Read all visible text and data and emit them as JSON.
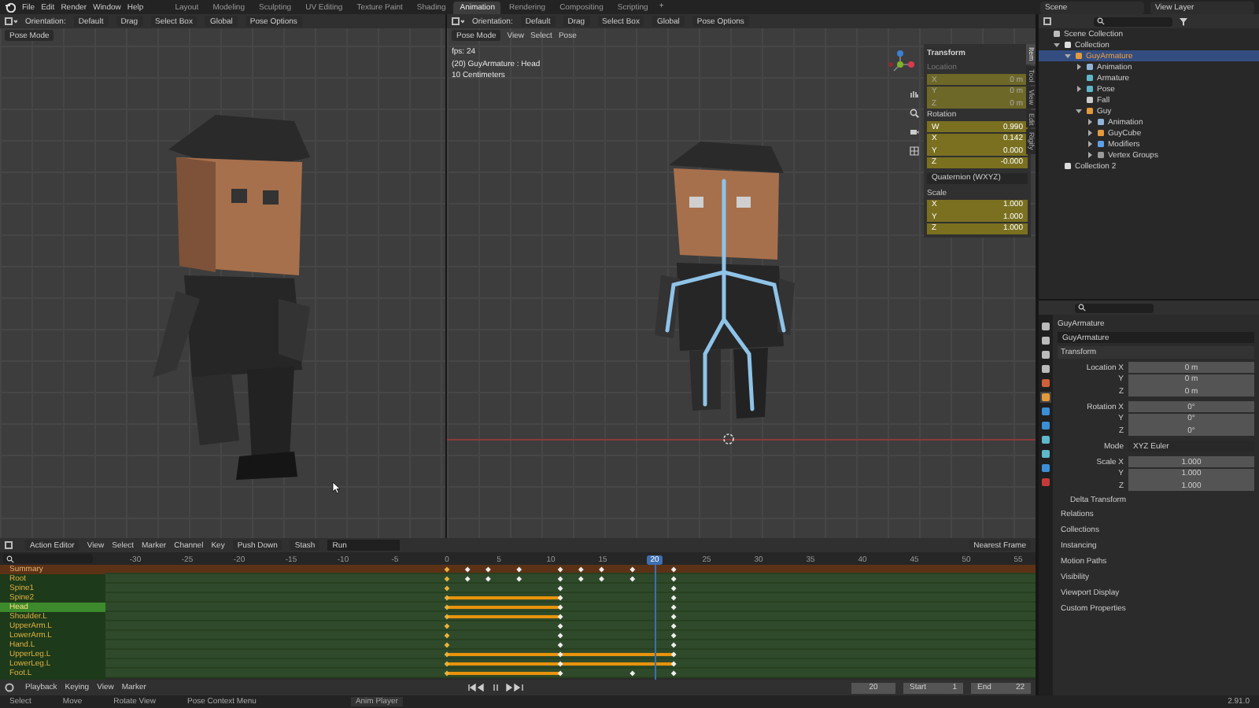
{
  "topbar": {
    "menus": [
      "File",
      "Edit",
      "Render",
      "Window",
      "Help"
    ],
    "workspaces": [
      {
        "label": "Layout",
        "selected": false
      },
      {
        "label": "Modeling",
        "selected": false
      },
      {
        "label": "Sculpting",
        "selected": false
      },
      {
        "label": "UV Editing",
        "selected": false
      },
      {
        "label": "Texture Paint",
        "selected": false
      },
      {
        "label": "Shading",
        "selected": false
      },
      {
        "label": "Animation",
        "selected": true
      },
      {
        "label": "Rendering",
        "selected": false
      },
      {
        "label": "Compositing",
        "selected": false
      },
      {
        "label": "Scripting",
        "selected": false
      }
    ],
    "add_tab": "+",
    "scene": "Scene",
    "view_layer": "View Layer"
  },
  "left_viewport": {
    "header": [
      "Orientation:",
      "Default",
      "Drag",
      "Select Box",
      "Global",
      "Pose Options"
    ],
    "mode": "Pose Mode"
  },
  "main_viewport": {
    "header": [
      "Orientation:",
      "Default",
      "Drag",
      "Select Box",
      "Global",
      "Pose Options"
    ],
    "mode": "Pose Mode",
    "menus": [
      "View",
      "Select",
      "Pose"
    ],
    "overlay": [
      "fps: 24",
      "(20) GuyArmature : Head",
      "10 Centimeters"
    ],
    "sidebar": {
      "title": "Transform",
      "tabs": [
        {
          "label": "Item",
          "selected": true
        },
        {
          "label": "Tool",
          "selected": false
        },
        {
          "label": "View",
          "selected": false
        },
        {
          "label": "Edit",
          "selected": false
        },
        {
          "label": "Rigify",
          "selected": false
        }
      ],
      "groups": [
        {
          "label": "Location",
          "disabled": true,
          "rows": [
            {
              "label": "X",
              "value": "0 m"
            },
            {
              "label": "Y",
              "value": "0 m"
            },
            {
              "label": "Z",
              "value": "0 m"
            }
          ]
        },
        {
          "label": "Rotation",
          "disabled": false,
          "rows": [
            {
              "label": "W",
              "value": "0.990"
            },
            {
              "label": "X",
              "value": "0.142"
            },
            {
              "label": "Y",
              "value": "0.000"
            },
            {
              "label": "Z",
              "value": "-0.000"
            }
          ]
        },
        {
          "label": "Scale",
          "disabled": false,
          "rows": [
            {
              "label": "X",
              "value": "1.000"
            },
            {
              "label": "Y",
              "value": "1.000"
            },
            {
              "label": "Z",
              "value": "1.000"
            }
          ]
        }
      ],
      "rotation_mode": "Quaternion (WXYZ)"
    }
  },
  "outliner": {
    "items": [
      {
        "label": "Scene Collection",
        "kind": "scene",
        "selected": false,
        "children": [
          {
            "label": "Collection",
            "kind": "collection",
            "expanded": true,
            "selected": false,
            "children": [
              {
                "label": "GuyArmature",
                "kind": "object",
                "expanded": true,
                "selected": true,
                "children": [
                  {
                    "label": "Animation",
                    "kind": "animation",
                    "expanded": false,
                    "selected": false
                  },
                  {
                    "label": "Armature",
                    "kind": "armature",
                    "selected": false
                  },
                  {
                    "label": "Pose",
                    "kind": "armature",
                    "expanded": false,
                    "selected": false
                  },
                  {
                    "label": "Fall",
                    "kind": "action",
                    "selected": false
                  },
                  {
                    "label": "Guy",
                    "kind": "mesh",
                    "expanded": true,
                    "selected": false,
                    "children": [
                      {
                        "label": "Animation",
                        "kind": "animation",
                        "expanded": false,
                        "selected": false
                      },
                      {
                        "label": "GuyCube",
                        "kind": "mesh",
                        "expanded": false,
                        "selected": false
                      },
                      {
                        "label": "Modifiers",
                        "kind": "modifier",
                        "expanded": false,
                        "selected": false
                      },
                      {
                        "label": "Vertex Groups",
                        "kind": "group",
                        "expanded": false,
                        "selected": false
                      }
                    ]
                  }
                ]
              }
            ]
          },
          {
            "label": "Collection 2",
            "kind": "collection",
            "selected": false
          }
        ]
      }
    ]
  },
  "properties": {
    "object": "GuyArmature",
    "object_field": "GuyArmature",
    "panel": "Transform",
    "groups": [
      {
        "rows": [
          {
            "label": "Location X",
            "value": "0 m",
            "kind": "field"
          },
          {
            "label": "Y",
            "value": "0 m",
            "kind": "field"
          },
          {
            "label": "Z",
            "value": "0 m",
            "kind": "field"
          }
        ]
      },
      {
        "rows": [
          {
            "label": "Rotation X",
            "value": "0°",
            "kind": "field"
          },
          {
            "label": "Y",
            "value": "0°",
            "kind": "field"
          },
          {
            "label": "Z",
            "value": "0°",
            "kind": "field"
          }
        ]
      },
      {
        "rows": [
          {
            "label": "Mode",
            "value": "XYZ Euler",
            "kind": "dropdown"
          }
        ]
      },
      {
        "rows": [
          {
            "label": "Scale X",
            "value": "1.000",
            "kind": "field"
          },
          {
            "label": "Y",
            "value": "1.000",
            "kind": "field"
          },
          {
            "label": "Z",
            "value": "1.000",
            "kind": "field"
          }
        ]
      }
    ],
    "subpanel": "Delta Transform",
    "sections": [
      "Relations",
      "Collections",
      "Instancing",
      "Motion Paths",
      "Visibility",
      "Viewport Display",
      "Custom Properties"
    ]
  },
  "dopesheet": {
    "mode": "Action Editor",
    "menus": [
      "View",
      "Select",
      "Marker",
      "Channel",
      "Key"
    ],
    "push_down": "Push Down",
    "stash": "Stash",
    "action": "Run",
    "snapping": "Nearest Frame",
    "ruler": [
      {
        "label": "-30",
        "selected": false
      },
      {
        "label": "-25",
        "selected": false
      },
      {
        "label": "-20",
        "selected": false
      },
      {
        "label": "-15",
        "selected": false
      },
      {
        "label": "-10",
        "selected": false
      },
      {
        "label": "-5",
        "selected": false
      },
      {
        "label": "0",
        "selected": false
      },
      {
        "label": "5",
        "selected": false
      },
      {
        "label": "10",
        "selected": false
      },
      {
        "label": "15",
        "selected": false
      },
      {
        "label": "20",
        "selected": true
      },
      {
        "label": "25",
        "selected": false
      },
      {
        "label": "30",
        "selected": false
      },
      {
        "label": "35",
        "selected": false
      },
      {
        "label": "40",
        "selected": false
      },
      {
        "label": "45",
        "selected": false
      },
      {
        "label": "50",
        "selected": false
      },
      {
        "label": "55",
        "selected": false
      }
    ],
    "channels": [
      {
        "name": "Summary",
        "kind": "summary",
        "selected": false
      },
      {
        "name": "Root",
        "kind": "bone",
        "selected": false
      },
      {
        "name": "Spine1",
        "kind": "bone",
        "selected": false
      },
      {
        "name": "Spine2",
        "kind": "bone",
        "selected": false
      },
      {
        "name": "Head",
        "kind": "bone",
        "selected": true
      },
      {
        "name": "Shoulder.L",
        "kind": "bone",
        "selected": false
      },
      {
        "name": "UpperArm.L",
        "kind": "bone",
        "selected": false
      },
      {
        "name": "LowerArm.L",
        "kind": "bone",
        "selected": false
      },
      {
        "name": "Hand.L",
        "kind": "bone",
        "selected": false
      },
      {
        "name": "UpperLeg.L",
        "kind": "bone",
        "selected": false
      },
      {
        "name": "LowerLeg.L",
        "kind": "bone",
        "selected": false
      },
      {
        "name": "Foot.L",
        "kind": "bone",
        "selected": false
      }
    ]
  },
  "timeline": {
    "menus": [
      "Playback",
      "Keying",
      "View",
      "Marker"
    ],
    "current_frame": "20",
    "start_label": "Start",
    "start": "1",
    "end_label": "End",
    "end": "22"
  },
  "status_bar": {
    "hints": [
      "Select",
      "Move",
      "Rotate View",
      "Pose Context Menu"
    ],
    "player": "Anim Player",
    "version": "2.91.0"
  }
}
